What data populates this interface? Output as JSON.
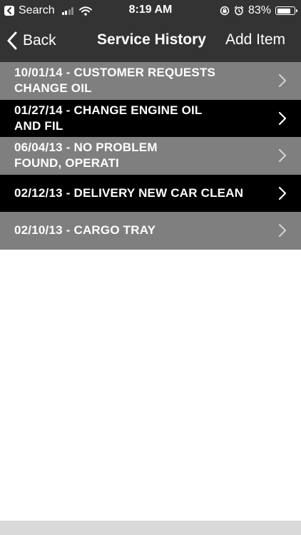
{
  "status_bar": {
    "back_app_label": "Search",
    "time": "8:19 AM",
    "battery_percent": "83%",
    "battery_level": 0.83,
    "signal_bars_active": 2,
    "icons": [
      "back-to-app-icon",
      "signal-icon",
      "wifi-icon",
      "rotation-lock-icon",
      "alarm-icon",
      "battery-icon"
    ]
  },
  "nav": {
    "back_label": "Back",
    "title": "Service History",
    "add_label": "Add Item"
  },
  "colors": {
    "header_bg": "#333333",
    "row_gray": "#7f7f7f",
    "row_black": "#000000",
    "text": "#ffffff",
    "chevron_on_gray": "#d0d0d0",
    "chevron_on_black": "#ffffff",
    "bottom_strip": "#d9d9d9"
  },
  "service_items": [
    {
      "line1": "10/01/14 - CUSTOMER REQUESTS",
      "line2": "CHANGE OIL",
      "style": "gray"
    },
    {
      "line1": "01/27/14 - CHANGE ENGINE OIL",
      "line2": "AND FIL",
      "style": "black"
    },
    {
      "line1": "06/04/13 - NO PROBLEM",
      "line2": "FOUND, OPERATI",
      "style": "gray"
    },
    {
      "line1": "02/12/13 - DELIVERY NEW CAR CLEAN",
      "line2": "",
      "style": "black"
    },
    {
      "line1": "02/10/13 - CARGO TRAY",
      "line2": "",
      "style": "gray"
    }
  ]
}
